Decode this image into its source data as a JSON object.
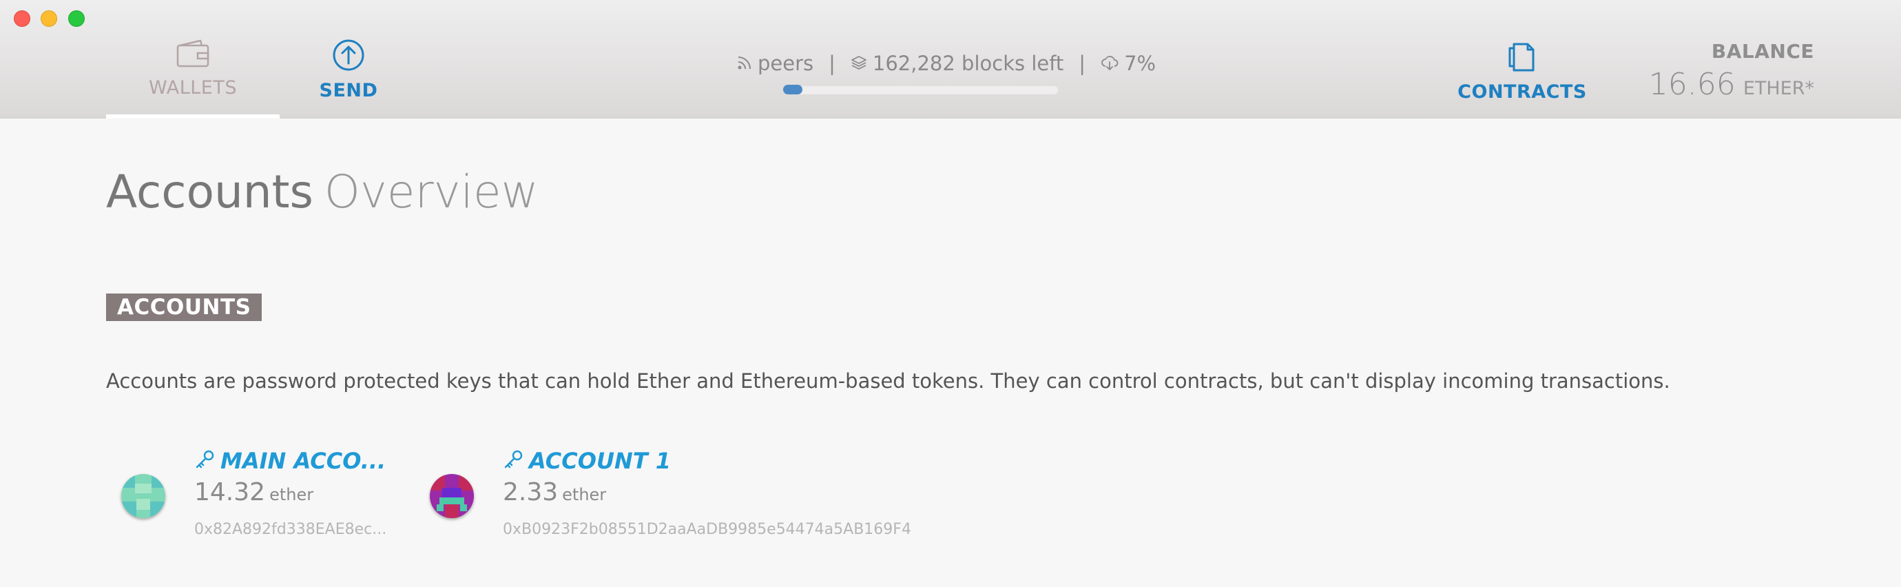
{
  "nav": {
    "wallets_label": "WALLETS",
    "send_label": "SEND",
    "contracts_label": "CONTRACTS"
  },
  "sync": {
    "peers_text": "peers",
    "blocks_left_text": "162,282 blocks left",
    "download_percent_text": "7%",
    "progress_fraction": 0.07
  },
  "balance": {
    "label": "BALANCE",
    "value": "16.66",
    "unit": "ETHER*"
  },
  "page": {
    "title_main": "Accounts",
    "title_sub": "Overview"
  },
  "accounts_section": {
    "heading": "ACCOUNTS",
    "description": "Accounts are password protected keys that can hold Ether and Ethereum-based tokens. They can control contracts, but can't display incoming transactions.",
    "items": [
      {
        "name": "MAIN ACCO...",
        "balance": "14.32",
        "unit": "ether",
        "address": "0x82A892fd338EAE8ec..."
      },
      {
        "name": "ACCOUNT 1",
        "balance": "2.33",
        "unit": "ether",
        "address": "0xB0923F2b08551D2aaAaDB9985e54474a5AB169F4"
      }
    ]
  },
  "colors": {
    "accent_blue": "#1e80c1",
    "account_name_blue": "#1f9ad6",
    "section_heading_bg": "#867b7b",
    "progress_fill": "#4b8ac6"
  },
  "icons": {
    "wallets": "wallet-icon",
    "send": "send-arrow-up-icon",
    "contracts": "documents-icon",
    "peers": "rss-signal-icon",
    "blocks": "layers-icon",
    "download": "cloud-download-icon",
    "account_key": "key-icon"
  }
}
